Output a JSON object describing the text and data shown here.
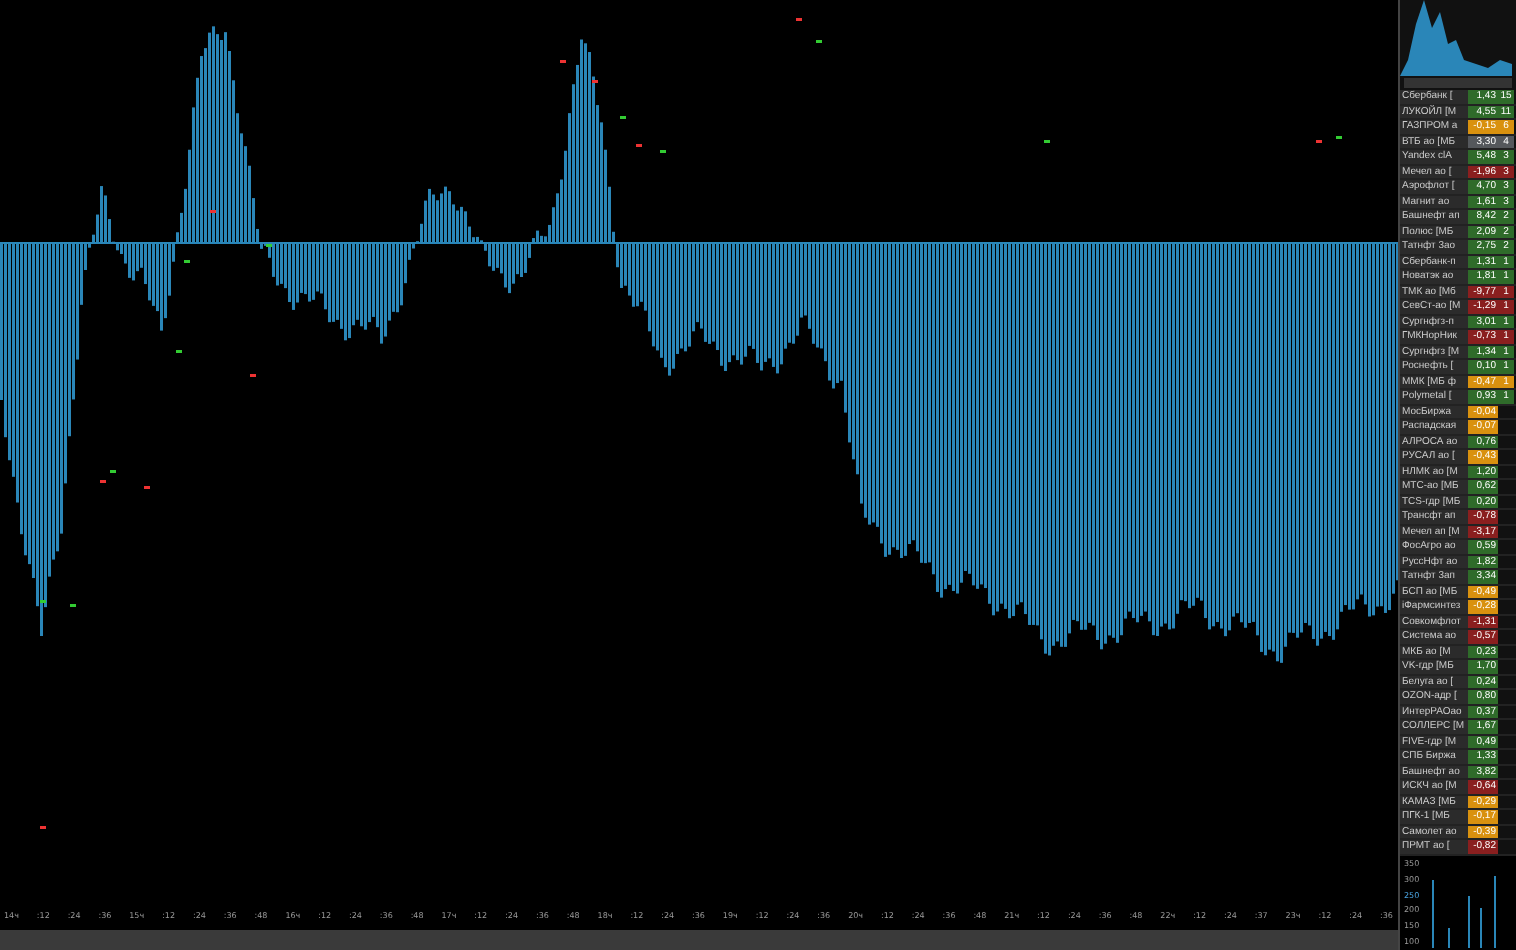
{
  "time_axis": {
    "labels": [
      "14ч",
      ":12",
      ":24",
      ":36",
      "15ч",
      ":12",
      ":24",
      ":36",
      ":48",
      "16ч",
      ":12",
      ":24",
      ":36",
      ":48",
      "17ч",
      ":12",
      ":24",
      ":36",
      ":48",
      "18ч",
      ":12",
      ":24",
      ":36",
      "19ч",
      ":12",
      ":24",
      ":36",
      "20ч",
      ":12",
      ":24",
      ":36",
      ":48",
      "21ч",
      ":12",
      ":24",
      ":36",
      ":48",
      "22ч",
      ":12",
      ":24",
      ":37",
      "23ч",
      ":12",
      ":24",
      ":36"
    ]
  },
  "watchlist": {
    "rows": [
      {
        "name": "Сбербанк [",
        "change": "1,43",
        "count": "15",
        "color": "#2f6b2a"
      },
      {
        "name": "ЛУКОЙЛ [М",
        "change": "4,55",
        "count": "11",
        "color": "#2f6b2a"
      },
      {
        "name": "ГАЗПРОМ а",
        "change": "-0,15",
        "count": "6",
        "color": "#d9910f"
      },
      {
        "name": "ВТБ ао [МБ",
        "change": "3,30",
        "count": "4",
        "color": "#55585c"
      },
      {
        "name": "Yandex clA",
        "change": "5,48",
        "count": "3",
        "color": "#2f6b2a"
      },
      {
        "name": "Мечел ао [",
        "change": "-1,96",
        "count": "3",
        "color": "#8a1f1f"
      },
      {
        "name": "Аэрофлот [",
        "change": "4,70",
        "count": "3",
        "color": "#2f6b2a"
      },
      {
        "name": "Магнит ао",
        "change": "1,61",
        "count": "3",
        "color": "#2f6b2a"
      },
      {
        "name": "Башнефт ап",
        "change": "8,42",
        "count": "2",
        "color": "#2f6b2a"
      },
      {
        "name": "Полюс [МБ",
        "change": "2,09",
        "count": "2",
        "color": "#2f6b2a"
      },
      {
        "name": "Татнфт 3ао",
        "change": "2,75",
        "count": "2",
        "color": "#2f6b2a"
      },
      {
        "name": "Сбербанк-п",
        "change": "1,31",
        "count": "1",
        "color": "#2f6b2a"
      },
      {
        "name": "Новатэк ао",
        "change": "1,81",
        "count": "1",
        "color": "#2f6b2a"
      },
      {
        "name": "ТМК ао [Мб",
        "change": "-9,77",
        "count": "1",
        "color": "#8a1f1f"
      },
      {
        "name": "СевСт-ао [М",
        "change": "-1,29",
        "count": "1",
        "color": "#8a1f1f"
      },
      {
        "name": "Сургнфгз-п",
        "change": "3,01",
        "count": "1",
        "color": "#2f6b2a"
      },
      {
        "name": "ГМКНорНик",
        "change": "-0,73",
        "count": "1",
        "color": "#8a1f1f"
      },
      {
        "name": "Сургнфгз [М",
        "change": "1,34",
        "count": "1",
        "color": "#2f6b2a"
      },
      {
        "name": "Роснефть [",
        "change": "0,10",
        "count": "1",
        "color": "#2f6b2a"
      },
      {
        "name": "ММК [МБ ф",
        "change": "-0,47",
        "count": "1",
        "color": "#d9910f"
      },
      {
        "name": "Polymetal [",
        "change": "0,93",
        "count": "1",
        "color": "#2f6b2a"
      },
      {
        "name": "МосБиржа",
        "change": "-0,04",
        "color": "#d9910f"
      },
      {
        "name": "Распадская",
        "change": "-0,07",
        "color": "#d9910f"
      },
      {
        "name": "АЛРОСА ао",
        "change": "0,76",
        "color": "#2f6b2a"
      },
      {
        "name": "РУСАЛ ао [",
        "change": "-0,43",
        "color": "#d9910f"
      },
      {
        "name": "НЛМК ао [М",
        "change": "1,20",
        "color": "#2f6b2a"
      },
      {
        "name": "МТС-ао [МБ",
        "change": "0,62",
        "color": "#2f6b2a"
      },
      {
        "name": "TCS-гдр [МБ",
        "change": "0,20",
        "color": "#2f6b2a"
      },
      {
        "name": "Трансфт ап",
        "change": "-0,78",
        "color": "#8a1f1f"
      },
      {
        "name": "Мечел ап [М",
        "change": "-3,17",
        "color": "#8a1f1f"
      },
      {
        "name": "ФосАгро ао",
        "change": "0,59",
        "color": "#2f6b2a"
      },
      {
        "name": "РуссНфт ао",
        "change": "1,82",
        "color": "#2f6b2a"
      },
      {
        "name": "Татнфт 3ап",
        "change": "3,34",
        "color": "#2f6b2a"
      },
      {
        "name": "БСП ао [МБ",
        "change": "-0,49",
        "color": "#d9910f"
      },
      {
        "name": "iФармсинтез",
        "change": "-0,28",
        "color": "#d9910f"
      },
      {
        "name": "Совкомфлот",
        "change": "-1,31",
        "color": "#8a1f1f"
      },
      {
        "name": "Система ао",
        "change": "-0,57",
        "color": "#8a1f1f"
      },
      {
        "name": "МКБ ао [М",
        "change": "0,23",
        "color": "#2f6b2a"
      },
      {
        "name": "VK-гдр [МБ",
        "change": "1,70",
        "color": "#2f6b2a"
      },
      {
        "name": "Белуга ао [",
        "change": "0,24",
        "color": "#2f6b2a"
      },
      {
        "name": "OZON-адр [",
        "change": "0,80",
        "color": "#2f6b2a"
      },
      {
        "name": "ИнтерРАОао",
        "change": "0,37",
        "color": "#2f6b2a"
      },
      {
        "name": "СОЛЛЕРС [М",
        "change": "1,67",
        "color": "#2f6b2a"
      },
      {
        "name": "FIVE-гдр [М",
        "change": "0,49",
        "color": "#2f6b2a"
      },
      {
        "name": "СПБ Биржа",
        "change": "1,33",
        "color": "#2f6b2a"
      },
      {
        "name": "Башнефт ао",
        "change": "3,82",
        "color": "#2f6b2a"
      },
      {
        "name": "ИСКЧ ао [М",
        "change": "-0,64",
        "color": "#8a1f1f"
      },
      {
        "name": "КАМАЗ [МБ",
        "change": "-0,29",
        "color": "#d9910f"
      },
      {
        "name": "ПГК-1 [МБ",
        "change": "-0,17",
        "color": "#d9910f"
      },
      {
        "name": "Самолет ао",
        "change": "-0,39",
        "color": "#d9910f"
      },
      {
        "name": "ПРМТ ао [",
        "change": "-0,82",
        "color": "#8a1f1f"
      }
    ]
  },
  "volume_chart": {
    "yticks": [
      {
        "label": "350",
        "selected": false
      },
      {
        "label": "300",
        "selected": false
      },
      {
        "label": "250",
        "selected": true
      },
      {
        "label": "200",
        "selected": false
      },
      {
        "label": "150",
        "selected": false
      },
      {
        "label": "100",
        "selected": false
      }
    ]
  }
}
